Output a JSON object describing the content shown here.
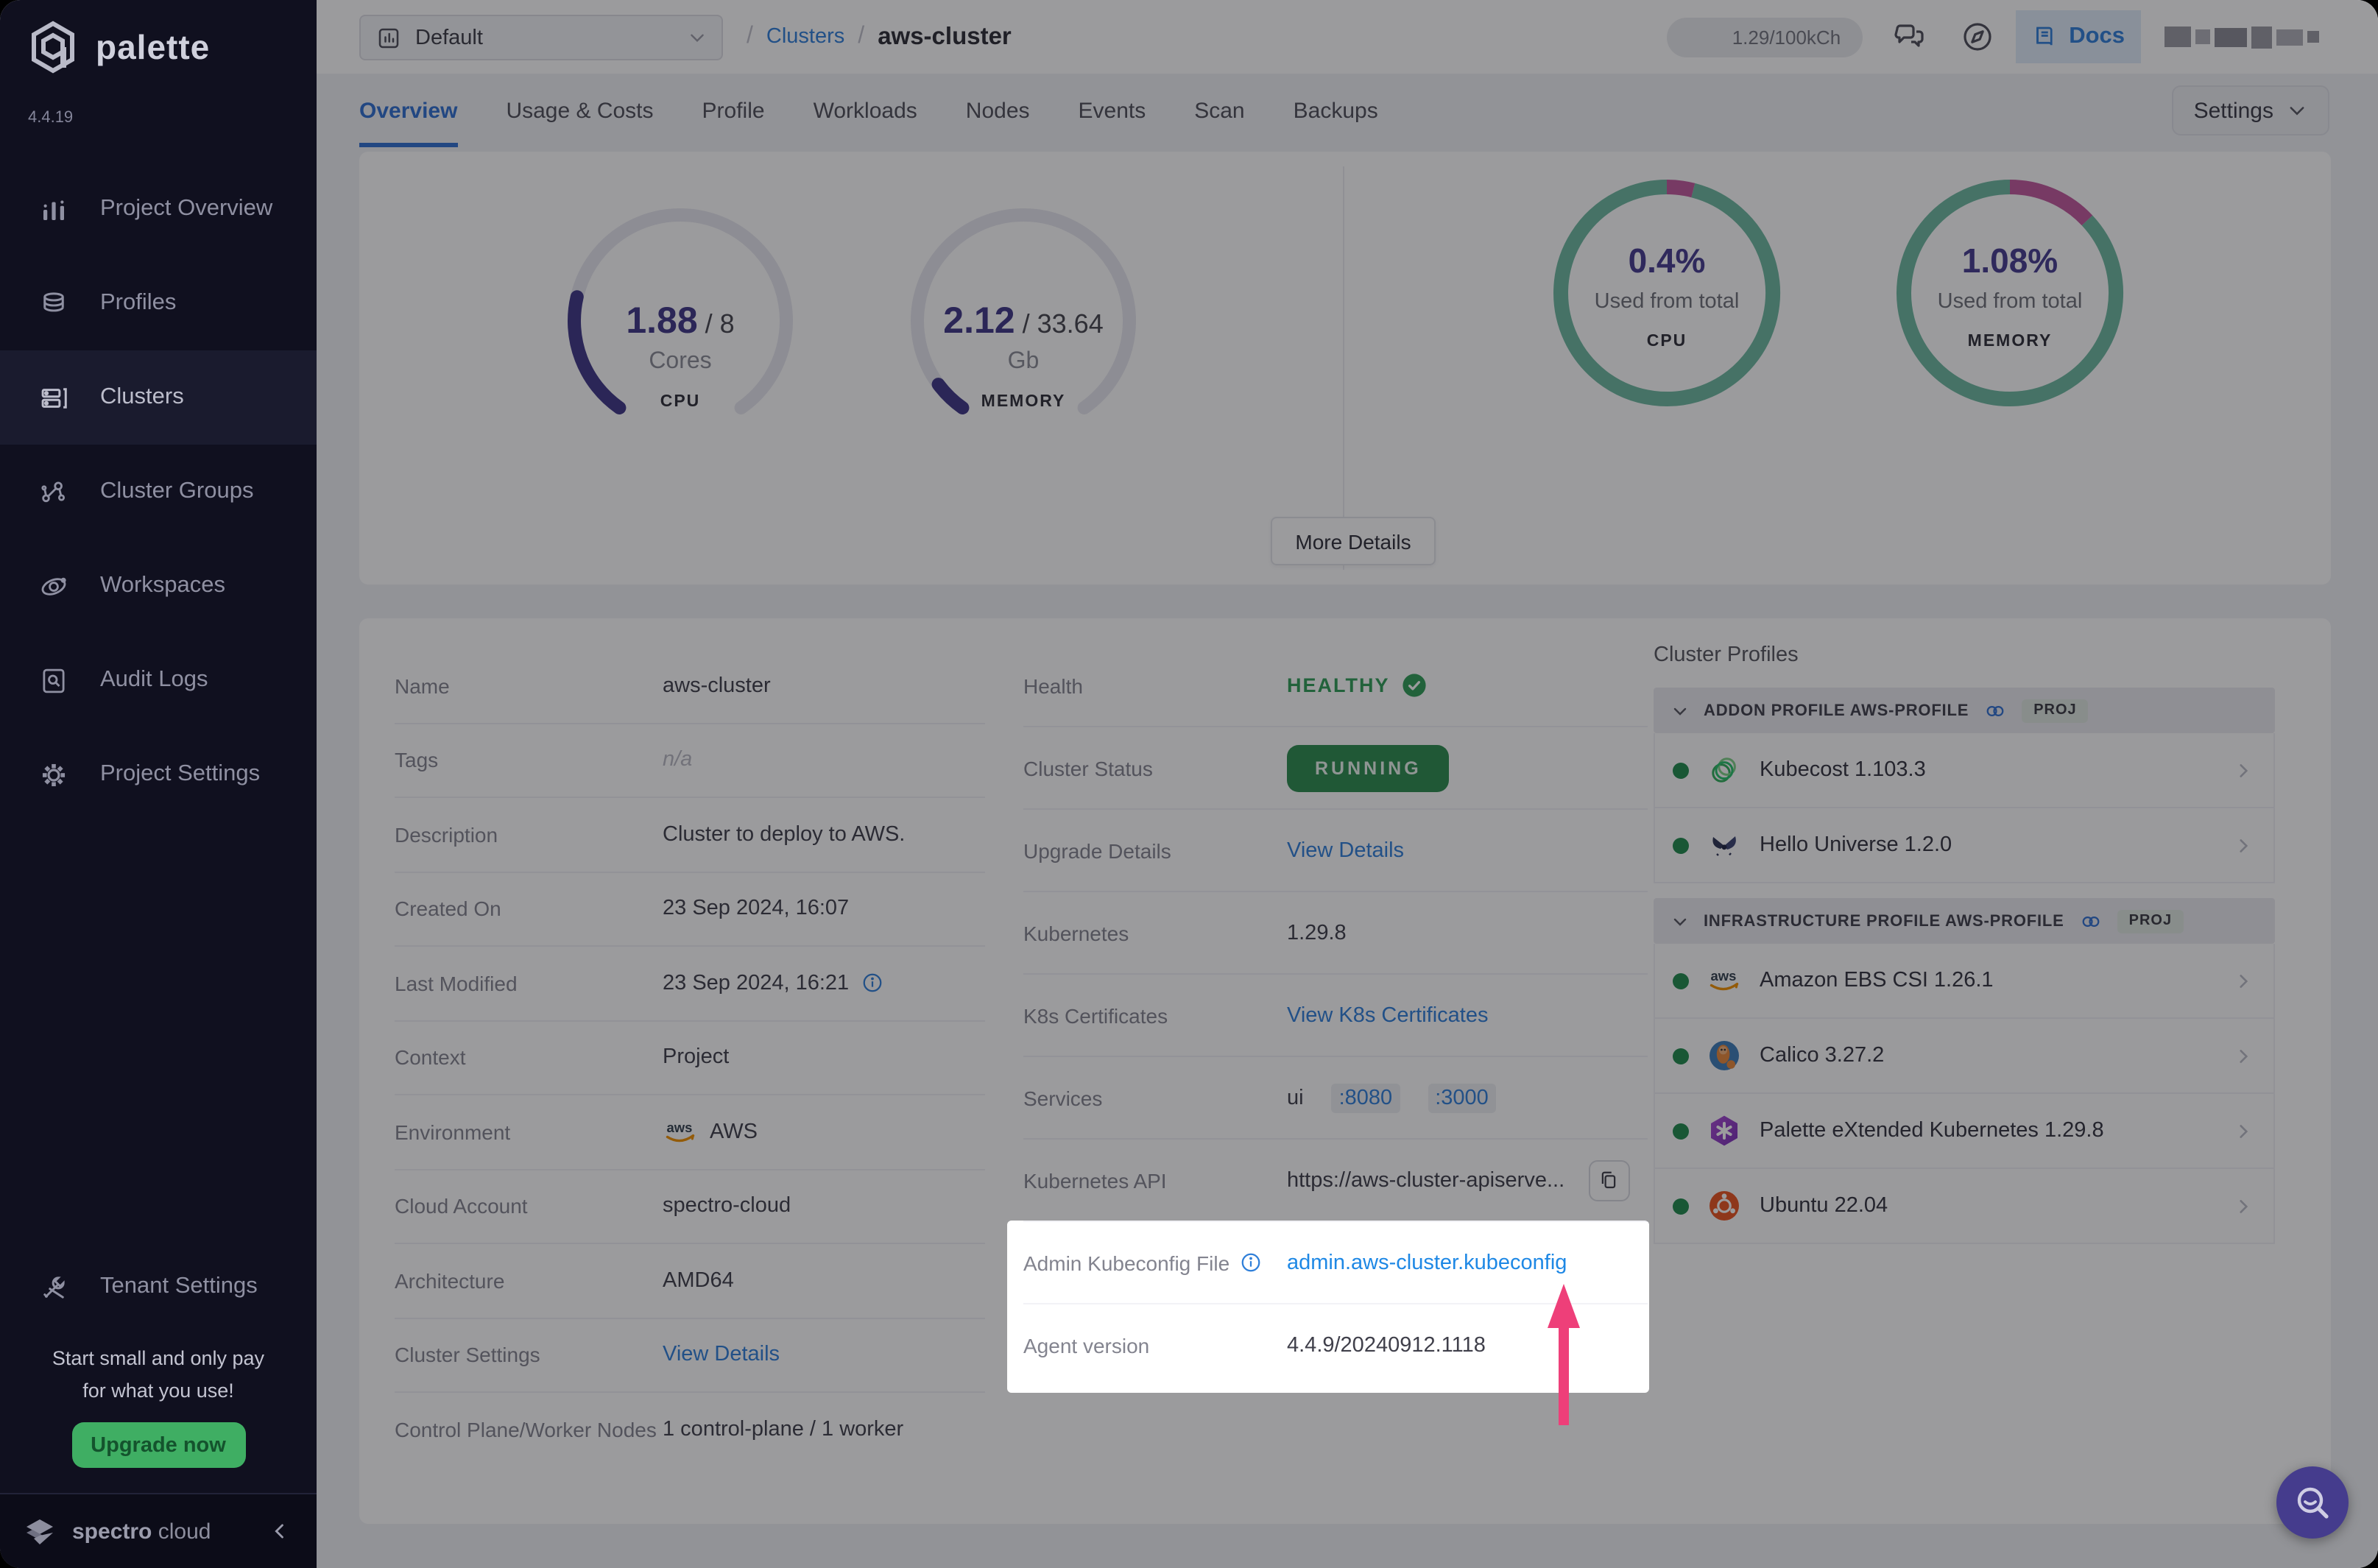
{
  "app": {
    "name": "palette",
    "version": "4.4.19"
  },
  "sidebar": {
    "items": [
      {
        "label": "Project Overview",
        "icon": "bar-chart"
      },
      {
        "label": "Profiles",
        "icon": "layers"
      },
      {
        "label": "Clusters",
        "icon": "server",
        "active": true
      },
      {
        "label": "Cluster Groups",
        "icon": "network"
      },
      {
        "label": "Workspaces",
        "icon": "orbit"
      },
      {
        "label": "Audit Logs",
        "icon": "doc-search"
      },
      {
        "label": "Project Settings",
        "icon": "gear"
      }
    ],
    "tenant_label": "Tenant Settings",
    "promo_line1": "Start small and only pay",
    "promo_line2": "for what you use!",
    "upgrade_label": "Upgrade now",
    "brand_word1": "spectro",
    "brand_word2": "cloud"
  },
  "topbar": {
    "project_selector": "Default",
    "breadcrumb": {
      "sep": "/",
      "link": "Clusters",
      "current": "aws-cluster"
    },
    "usage_pill": "1.29/100kCh",
    "docs_label": "Docs"
  },
  "tabs": {
    "items": [
      "Overview",
      "Usage & Costs",
      "Profile",
      "Workloads",
      "Nodes",
      "Events",
      "Scan",
      "Backups"
    ],
    "active_index": 0
  },
  "settings_button": {
    "label": "Settings"
  },
  "metrics": {
    "more_details": "More Details"
  },
  "chart_data": [
    {
      "type": "gauge",
      "id": "cpu",
      "value": 1.88,
      "max": 8,
      "value_label": "1.88",
      "max_label": "8",
      "unit": "Cores",
      "footer": "CPU",
      "fill_color": "#3e3687",
      "track_color": "#e7e7ef",
      "arc_start_deg": 125,
      "arc_span_deg": 290
    },
    {
      "type": "gauge",
      "id": "memory",
      "value": 2.12,
      "max": 33.64,
      "value_label": "2.12",
      "max_label": "33.64",
      "unit": "Gb",
      "footer": "MEMORY",
      "fill_color": "#3e3687",
      "track_color": "#e7e7ef",
      "arc_start_deg": 125,
      "arc_span_deg": 290
    },
    {
      "type": "donut",
      "id": "cpu-total",
      "center": "0.4%",
      "subtitle": "Used from total",
      "footer": "CPU",
      "segments": [
        {
          "name": "used",
          "fraction": 0.04,
          "color": "#c2589d"
        },
        {
          "name": "free",
          "fraction": 0.96,
          "color": "#6db9a0"
        }
      ]
    },
    {
      "type": "donut",
      "id": "memory-total",
      "center": "1.08%",
      "subtitle": "Used from total",
      "footer": "MEMORY",
      "segments": [
        {
          "name": "used",
          "fraction": 0.13,
          "color": "#c2589d"
        },
        {
          "name": "free",
          "fraction": 0.87,
          "color": "#6db9a0"
        }
      ]
    }
  ],
  "details": {
    "left_rows": [
      {
        "label": "Name",
        "kind": "text",
        "value": "aws-cluster"
      },
      {
        "label": "Tags",
        "kind": "muted",
        "value": "n/a"
      },
      {
        "label": "Description",
        "kind": "text",
        "value": "Cluster to deploy to AWS."
      },
      {
        "label": "Created On",
        "kind": "text",
        "value": "23 Sep 2024, 16:07"
      },
      {
        "label": "Last Modified",
        "kind": "text",
        "value": "23 Sep 2024, 16:21",
        "value_info": true
      },
      {
        "label": "Context",
        "kind": "text",
        "value": "Project"
      },
      {
        "label": "Environment",
        "kind": "aws",
        "value": "AWS"
      },
      {
        "label": "Cloud Account",
        "kind": "text",
        "value": "spectro-cloud"
      },
      {
        "label": "Architecture",
        "kind": "text",
        "value": "AMD64"
      },
      {
        "label": "Cluster Settings",
        "kind": "link",
        "value": "View Details"
      },
      {
        "label": "Control Plane/Worker Nodes",
        "kind": "text",
        "value": "1 control-plane / 1 worker"
      }
    ],
    "mid_rows": [
      {
        "label": "Health",
        "kind": "health",
        "value": "HEALTHY"
      },
      {
        "label": "Cluster Status",
        "kind": "pill",
        "value": "RUNNING"
      },
      {
        "label": "Upgrade Details",
        "kind": "link",
        "value": "View Details"
      },
      {
        "label": "Kubernetes",
        "kind": "text",
        "value": "1.29.8"
      },
      {
        "label": "K8s Certificates",
        "kind": "link",
        "value": "View K8s Certificates"
      },
      {
        "label": "Services",
        "kind": "services",
        "prefix": "ui",
        "ports": [
          ":8080",
          ":3000"
        ]
      },
      {
        "label": "Kubernetes API",
        "kind": "api",
        "value": "https://aws-cluster-apiserve..."
      },
      {
        "label": "Admin Kubeconfig File",
        "kind": "link",
        "value": "admin.aws-cluster.kubeconfig",
        "label_info": true,
        "bright": true
      },
      {
        "label": "Agent version",
        "kind": "text",
        "value": "4.4.9/20240912.1118"
      }
    ]
  },
  "profiles": {
    "title": "Cluster Profiles",
    "groups": [
      {
        "header": "ADDON PROFILE AWS-PROFILE",
        "badge": "PROJ",
        "items": [
          {
            "name": "Kubecost 1.103.3",
            "logo": "kubecost"
          },
          {
            "name": "Hello Universe 1.2.0",
            "logo": "hello-universe"
          }
        ]
      },
      {
        "header": "INFRASTRUCTURE PROFILE AWS-PROFILE",
        "badge": "PROJ",
        "items": [
          {
            "name": "Amazon EBS CSI 1.26.1",
            "logo": "aws"
          },
          {
            "name": "Calico 3.27.2",
            "logo": "calico"
          },
          {
            "name": "Palette eXtended Kubernetes 1.29.8",
            "logo": "pxk"
          },
          {
            "name": "Ubuntu 22.04",
            "logo": "ubuntu"
          }
        ]
      }
    ]
  },
  "colors": {
    "accent_blue": "#2f7fd9",
    "bright_link": "#1e88e5",
    "health_green": "#2f9e57",
    "status_pill_green": "#2b8c4f",
    "gauge_fill": "#3e3687",
    "donut_green": "#6db9a0",
    "donut_pink": "#c2589d",
    "arrow_pink": "#ee3f79",
    "upgrade_green": "#3fae63",
    "sidebar_bg": "#10101f",
    "dim_overlay": "rgba(16,16,22,0.42)"
  }
}
